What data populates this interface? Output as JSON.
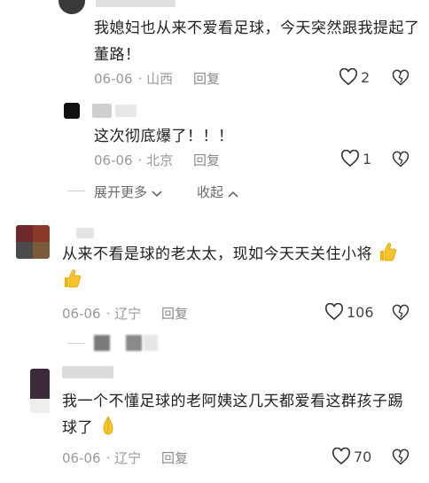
{
  "comment1": {
    "text": "我媳妇也从来不爱看足球，今天突然跟我提起了董路！",
    "date": "06-06",
    "location": "山西",
    "reply_label": "回复",
    "likes": "2"
  },
  "reply1": {
    "text": "这次彻底爆了！！！",
    "date": "06-06",
    "location": "北京",
    "reply_label": "回复",
    "likes": "1"
  },
  "thread_controls": {
    "expand": "展开更多",
    "collapse": "收起"
  },
  "comment2": {
    "text": "从来不看是球的老太太，现如今天天关住小将",
    "date": "06-06",
    "location": "辽宁",
    "reply_label": "回复",
    "likes": "106"
  },
  "comment3": {
    "text": "我一个不懂足球的老阿姨这几天都爱看这群孩子踢球了",
    "date": "06-06",
    "location": "辽宁",
    "reply_label": "回复",
    "likes": "70"
  },
  "colors": {
    "text": "#1f1f1f",
    "meta": "#9a9a9a",
    "emoji": "#f4b400"
  }
}
